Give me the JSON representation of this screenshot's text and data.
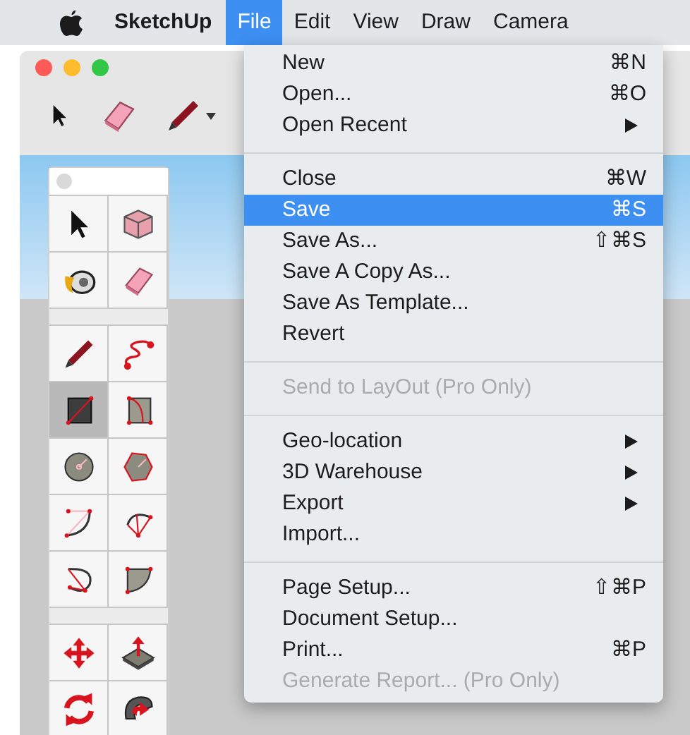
{
  "menubar": {
    "app_name": "SketchUp",
    "items": [
      {
        "label": "File",
        "selected": true
      },
      {
        "label": "Edit",
        "selected": false
      },
      {
        "label": "View",
        "selected": false
      },
      {
        "label": "Draw",
        "selected": false
      },
      {
        "label": "Camera",
        "selected": false
      }
    ]
  },
  "toolbar": {
    "tools": [
      {
        "kind": "select"
      },
      {
        "kind": "eraser"
      },
      {
        "kind": "pencil"
      }
    ]
  },
  "palette": {
    "groups": [
      {
        "tools": [
          {
            "kind": "select",
            "selected": false
          },
          {
            "kind": "component",
            "selected": false
          },
          {
            "kind": "paint",
            "selected": false
          },
          {
            "kind": "eraser",
            "selected": false
          }
        ]
      },
      {
        "tools": [
          {
            "kind": "pencil",
            "selected": false
          },
          {
            "kind": "freehand",
            "selected": false
          },
          {
            "kind": "rectangle",
            "selected": true
          },
          {
            "kind": "rotated-rectangle",
            "selected": false
          },
          {
            "kind": "circle",
            "selected": false
          },
          {
            "kind": "polygon",
            "selected": false
          },
          {
            "kind": "arc",
            "selected": false
          },
          {
            "kind": "two-point-arc",
            "selected": false
          },
          {
            "kind": "three-point-arc",
            "selected": false
          },
          {
            "kind": "pie",
            "selected": false
          }
        ]
      },
      {
        "tools": [
          {
            "kind": "move",
            "selected": false
          },
          {
            "kind": "pushpull",
            "selected": false
          },
          {
            "kind": "rotate",
            "selected": false
          },
          {
            "kind": "followme",
            "selected": false
          }
        ]
      }
    ]
  },
  "file_menu": {
    "sections": [
      {
        "items": [
          {
            "label": "New",
            "shortcut": "⌘N",
            "submenu": false,
            "disabled": false,
            "selected": false
          },
          {
            "label": "Open...",
            "shortcut": "⌘O",
            "submenu": false,
            "disabled": false,
            "selected": false
          },
          {
            "label": "Open Recent",
            "submenu": true,
            "disabled": false,
            "selected": false
          }
        ]
      },
      {
        "items": [
          {
            "label": "Close",
            "shortcut": "⌘W",
            "submenu": false,
            "disabled": false,
            "selected": false
          },
          {
            "label": "Save",
            "shortcut": "⌘S",
            "submenu": false,
            "disabled": false,
            "selected": true
          },
          {
            "label": "Save As...",
            "shortcut": "⇧⌘S",
            "submenu": false,
            "disabled": false,
            "selected": false
          },
          {
            "label": "Save A Copy As...",
            "submenu": false,
            "disabled": false,
            "selected": false
          },
          {
            "label": "Save As Template...",
            "submenu": false,
            "disabled": false,
            "selected": false
          },
          {
            "label": "Revert",
            "submenu": false,
            "disabled": false,
            "selected": false
          }
        ]
      },
      {
        "items": [
          {
            "label": "Send to LayOut (Pro Only)",
            "submenu": false,
            "disabled": true,
            "selected": false
          }
        ]
      },
      {
        "items": [
          {
            "label": "Geo-location",
            "submenu": true,
            "disabled": false,
            "selected": false
          },
          {
            "label": "3D Warehouse",
            "submenu": true,
            "disabled": false,
            "selected": false
          },
          {
            "label": "Export",
            "submenu": true,
            "disabled": false,
            "selected": false
          },
          {
            "label": "Import...",
            "submenu": false,
            "disabled": false,
            "selected": false
          }
        ]
      },
      {
        "items": [
          {
            "label": "Page Setup...",
            "shortcut": "⇧⌘P",
            "submenu": false,
            "disabled": false,
            "selected": false
          },
          {
            "label": "Document Setup...",
            "submenu": false,
            "disabled": false,
            "selected": false
          },
          {
            "label": "Print...",
            "shortcut": "⌘P",
            "submenu": false,
            "disabled": false,
            "selected": false
          },
          {
            "label": "Generate Report... (Pro Only)",
            "submenu": false,
            "disabled": true,
            "selected": false
          }
        ]
      }
    ]
  }
}
